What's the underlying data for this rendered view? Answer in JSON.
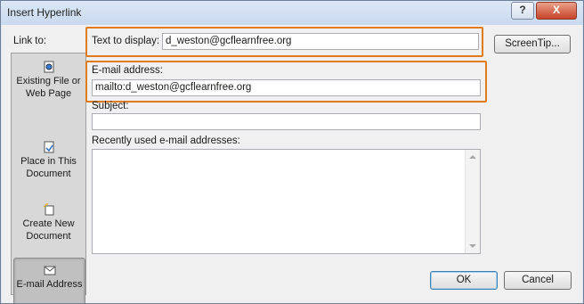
{
  "window": {
    "title": "Insert Hyperlink",
    "help_glyph": "?",
    "close_glyph": "X"
  },
  "sidebar": {
    "label": "Link to:",
    "items": [
      {
        "label_line1": "Existing File or",
        "label_line2": "Web Page",
        "icon": "web-page-icon",
        "selected": false
      },
      {
        "label_line1": "Place in This",
        "label_line2": "Document",
        "icon": "place-in-document-icon",
        "selected": false
      },
      {
        "label_line1": "Create New",
        "label_line2": "Document",
        "icon": "new-document-icon",
        "selected": false
      },
      {
        "label_line1": "E-mail Address",
        "label_line2": "",
        "icon": "email-icon",
        "selected": true
      }
    ]
  },
  "form": {
    "text_to_display_label": "Text to display:",
    "text_to_display_value": "d_weston@gcflearnfree.org",
    "screentip_label": "ScreenTip...",
    "email_label": "E-mail address:",
    "email_value": "mailto:d_weston@gcflearnfree.org",
    "subject_label": "Subject:",
    "subject_value": "",
    "recent_label": "Recently used e-mail addresses:",
    "recent_items": []
  },
  "buttons": {
    "ok": "OK",
    "cancel": "Cancel"
  },
  "colors": {
    "highlight": "#e07b1e",
    "titlebar": "#d2e0f2",
    "close": "#c7442a"
  }
}
